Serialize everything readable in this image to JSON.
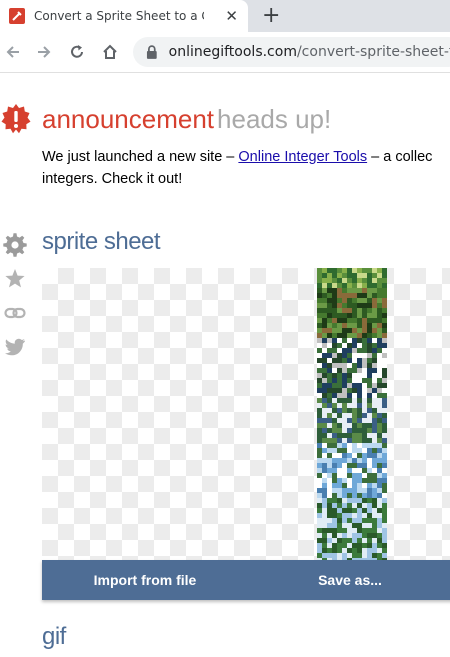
{
  "browser": {
    "tab_title": "Convert a Sprite Sheet to a GIF -",
    "tab_close": "✕",
    "new_tab": "+",
    "url_host": "onlinegiftools.com",
    "url_path": "/convert-sprite-sheet-to"
  },
  "announcement": {
    "title": "announcement",
    "subtitle": "heads up!",
    "text_before": "We just launched a new site – ",
    "link": "Online Integer Tools",
    "text_after": " – a collec",
    "line2": "integers. Check it out!"
  },
  "sprite_sheet": {
    "title": "sprite sheet",
    "import_label": "Import from file",
    "save_label": "Save as..."
  },
  "gif": {
    "title": "gif"
  },
  "colors": {
    "accent": "#d6402f",
    "section": "#4e6d95",
    "muted": "#a9a9a9"
  },
  "icons": [
    "tool-favicon",
    "back-arrow-icon",
    "forward-arrow-icon",
    "reload-icon",
    "home-icon",
    "lock-icon",
    "exclamation-badge-icon",
    "gear-icon",
    "star-icon",
    "link-icon",
    "twitter-icon"
  ]
}
